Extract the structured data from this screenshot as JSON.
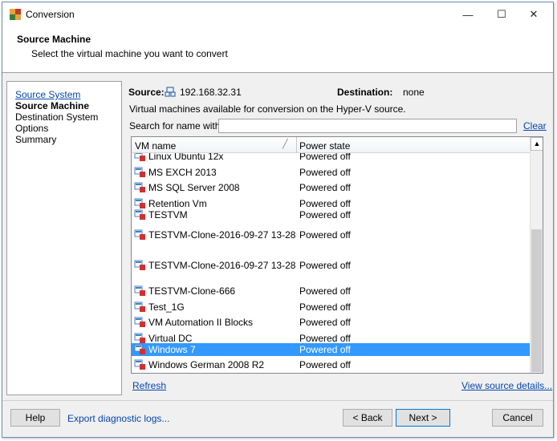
{
  "window": {
    "title": "Conversion",
    "minimize_glyph": "—",
    "maximize_glyph": "☐",
    "close_glyph": "✕"
  },
  "header": {
    "title": "Source Machine",
    "subtitle": "Select the virtual machine you want to convert"
  },
  "sidebar": {
    "items": [
      {
        "label": "Source System",
        "state": "link"
      },
      {
        "label": "Source Machine",
        "state": "active"
      },
      {
        "label": "Destination System",
        "state": "normal"
      },
      {
        "label": "Options",
        "state": "normal"
      },
      {
        "label": "Summary",
        "state": "normal"
      }
    ]
  },
  "source": {
    "label": "Source:",
    "value": "192.168.32.31",
    "destination_label": "Destination:",
    "destination_value": "none"
  },
  "description": "Virtual machines available for conversion on the Hyper-V source.",
  "search": {
    "label": "Search for name with:",
    "value": "",
    "clear_label": "Clear"
  },
  "table": {
    "columns": [
      "VM name",
      "Power state"
    ],
    "rows": [
      {
        "name": "Linux Ubuntu 12x",
        "state": "Powered off",
        "selected": false
      },
      {
        "name": "MS EXCH 2013",
        "state": "Powered off",
        "selected": false
      },
      {
        "name": "MS SQL Server 2008",
        "state": "Powered off",
        "selected": false
      },
      {
        "name": "Retention Vm",
        "state": "Powered off",
        "selected": false
      },
      {
        "name": "TESTVM",
        "state": "Powered off",
        "selected": false
      },
      {
        "name": "TESTVM-Clone-2016-09-27 13-28",
        "state": "Powered off",
        "selected": false
      },
      {
        "name": "TESTVM-Clone-2016-09-27 13-28",
        "state": "Powered off",
        "selected": false
      },
      {
        "name": "TESTVM-Clone-666",
        "state": "Powered off",
        "selected": false
      },
      {
        "name": "Test_1G",
        "state": "Powered off",
        "selected": false
      },
      {
        "name": "VM Automation II Blocks",
        "state": "Powered off",
        "selected": false
      },
      {
        "name": "Virtual DC",
        "state": "Powered off",
        "selected": false
      },
      {
        "name": "Windows 7",
        "state": "Powered off",
        "selected": true
      },
      {
        "name": "Windows German 2008 R2",
        "state": "Powered off",
        "selected": false
      }
    ]
  },
  "links": {
    "refresh": "Refresh",
    "view_source": "View source details..."
  },
  "footer": {
    "help": "Help",
    "export": "Export diagnostic logs...",
    "back": "< Back",
    "next": "Next >",
    "cancel": "Cancel"
  },
  "colors": {
    "selection": "#3399ff",
    "link": "#0645ad",
    "vm_icon_red": "#d32f2f",
    "vm_icon_blue": "#4a7fc1"
  },
  "icons": {
    "app": "converter-app-icon",
    "source": "network-computer-icon",
    "vm": "vm-powered-off-icon"
  }
}
